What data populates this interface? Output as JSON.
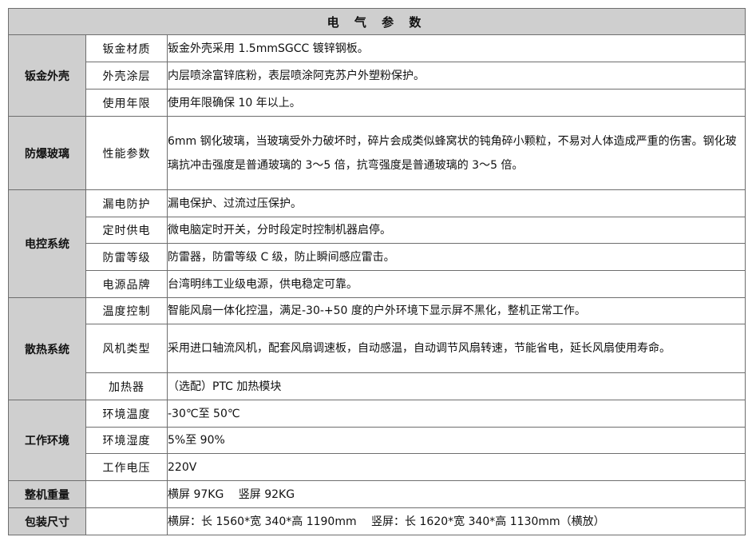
{
  "table": {
    "title": "电 气 参 数",
    "sections": {
      "sheet_metal": {
        "label": "钣金外壳",
        "rows": [
          {
            "item": "钣金材质",
            "value": "钣金外壳采用 1.5mmSGCC 镀锌钢板。"
          },
          {
            "item": "外壳涂层",
            "value": "内层喷涂富锌底粉，表层喷涂阿克苏户外塑粉保护。"
          },
          {
            "item": "使用年限",
            "value": "使用年限确保 10 年以上。"
          }
        ]
      },
      "glass": {
        "label": "防爆玻璃",
        "rows": [
          {
            "item": "性能参数",
            "value": "6mm 钢化玻璃，当玻璃受外力破坏时，碎片会成类似蜂窝状的钝角碎小颗粒，不易对人体造成严重的伤害。钢化玻璃抗冲击强度是普通玻璃的 3～5 倍，抗弯强度是普通玻璃的 3～5 倍。"
          }
        ]
      },
      "electrical": {
        "label": "电控系统",
        "rows": [
          {
            "item": "漏电防护",
            "value": "漏电保护、过流过压保护。"
          },
          {
            "item": "定时供电",
            "value": "微电脑定时开关，分时段定时控制机器启停。"
          },
          {
            "item": "防雷等级",
            "value": "防雷器，防雷等级 C 级，防止瞬间感应雷击。"
          },
          {
            "item": "电源品牌",
            "value": "台湾明纬工业级电源，供电稳定可靠。"
          }
        ]
      },
      "cooling": {
        "label": "散热系统",
        "rows": [
          {
            "item": "温度控制",
            "value": "智能风扇一体化控温，满足-30-+50 度的户外环境下显示屏不黑化，整机正常工作。"
          },
          {
            "item": "风机类型",
            "value": "采用进口轴流风机，配套风扇调速板，自动感温，自动调节风扇转速，节能省电，延长风扇使用寿命。"
          },
          {
            "item": "加热器",
            "value": "（选配）PTC 加热模块"
          }
        ]
      },
      "environment": {
        "label": "工作环境",
        "rows": [
          {
            "item": "环境温度",
            "value": "-30℃至 50℃"
          },
          {
            "item": "环境湿度",
            "value": "5%至 90%"
          },
          {
            "item": "工作电压",
            "value": "220V"
          }
        ]
      },
      "weight": {
        "label": "整机重量",
        "item": "",
        "value": "横屏 97KG　 竖屏 92KG"
      },
      "packing": {
        "label": "包装尺寸",
        "item": "",
        "value": "横屏：长 1560*宽 340*高 1190mm　 竖屏：长 1620*宽 340*高 1130mm（横放）"
      }
    }
  }
}
